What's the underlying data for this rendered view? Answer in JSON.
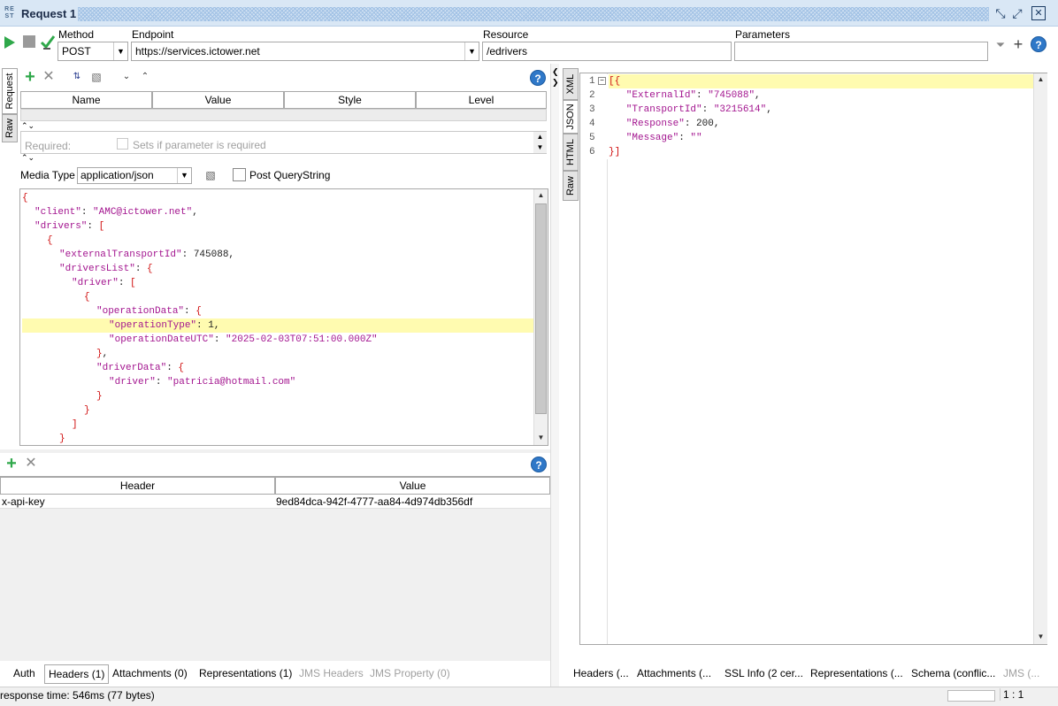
{
  "window": {
    "icon_text": "RE ST",
    "title": "Request 1"
  },
  "toolbar": {
    "method_label": "Method",
    "method_value": "POST",
    "endpoint_label": "Endpoint",
    "endpoint_value": "https://services.ictower.net",
    "resource_label": "Resource",
    "resource_value": "/edrivers",
    "parameters_label": "Parameters",
    "parameters_value": ""
  },
  "request_tabs": [
    "Request",
    "Raw"
  ],
  "response_tabs": [
    "XML",
    "JSON",
    "HTML",
    "Raw"
  ],
  "params_table": {
    "columns": [
      "Name",
      "Value",
      "Style",
      "Level"
    ],
    "required_label": "Required:",
    "required_hint": "Sets if parameter is required"
  },
  "media": {
    "label": "Media Type",
    "value": "application/json",
    "post_qs_label": "Post QueryString"
  },
  "request_body": [
    {
      "indent": 0,
      "tokens": [
        [
          "b",
          "{"
        ]
      ]
    },
    {
      "indent": 1,
      "tokens": [
        [
          "k",
          "\"client\""
        ],
        [
          "n",
          ": "
        ],
        [
          "s",
          "\"AMC@ictower.net\""
        ],
        [
          "n",
          ","
        ]
      ]
    },
    {
      "indent": 1,
      "tokens": [
        [
          "k",
          "\"drivers\""
        ],
        [
          "n",
          ": "
        ],
        [
          "b",
          "["
        ]
      ]
    },
    {
      "indent": 2,
      "tokens": [
        [
          "b",
          "{"
        ]
      ]
    },
    {
      "indent": 3,
      "tokens": [
        [
          "k",
          "\"externalTransportId\""
        ],
        [
          "n",
          ": "
        ],
        [
          "n",
          "745088,"
        ]
      ]
    },
    {
      "indent": 3,
      "tokens": [
        [
          "k",
          "\"driversList\""
        ],
        [
          "n",
          ": "
        ],
        [
          "b",
          "{"
        ]
      ]
    },
    {
      "indent": 4,
      "tokens": [
        [
          "k",
          "\"driver\""
        ],
        [
          "n",
          ": "
        ],
        [
          "b",
          "["
        ]
      ]
    },
    {
      "indent": 5,
      "tokens": [
        [
          "b",
          "{"
        ]
      ]
    },
    {
      "indent": 6,
      "tokens": [
        [
          "k",
          "\"operationData\""
        ],
        [
          "n",
          ": "
        ],
        [
          "b",
          "{"
        ]
      ]
    },
    {
      "indent": 7,
      "tokens": [
        [
          "k",
          "\"operationType\""
        ],
        [
          "n",
          ": 1,"
        ]
      ],
      "highlight": true
    },
    {
      "indent": 7,
      "tokens": [
        [
          "k",
          "\"operationDateUTC\""
        ],
        [
          "n",
          ": "
        ],
        [
          "s",
          "\"2025-02-03T07:51:00.000Z\""
        ]
      ]
    },
    {
      "indent": 6,
      "tokens": [
        [
          "b",
          "}"
        ],
        [
          "n",
          ","
        ]
      ]
    },
    {
      "indent": 6,
      "tokens": [
        [
          "k",
          "\"driverData\""
        ],
        [
          "n",
          ": "
        ],
        [
          "b",
          "{"
        ]
      ]
    },
    {
      "indent": 7,
      "tokens": [
        [
          "k",
          "\"driver\""
        ],
        [
          "n",
          ": "
        ],
        [
          "s",
          "\"patricia@hotmail.com\""
        ]
      ]
    },
    {
      "indent": 6,
      "tokens": [
        [
          "b",
          "}"
        ]
      ]
    },
    {
      "indent": 5,
      "tokens": [
        [
          "b",
          "}"
        ]
      ]
    },
    {
      "indent": 4,
      "tokens": [
        [
          "b",
          "]"
        ]
      ]
    },
    {
      "indent": 3,
      "tokens": [
        [
          "b",
          "}"
        ]
      ]
    }
  ],
  "headers_table": {
    "columns": [
      "Header",
      "Value"
    ],
    "rows": [
      {
        "header": "x-api-key",
        "value": "9ed84dca-942f-4777-aa84-4d974db356df"
      }
    ]
  },
  "request_bottom_tabs": [
    {
      "label": "Auth",
      "state": "normal"
    },
    {
      "label": "Headers (1)",
      "state": "active"
    },
    {
      "label": "Attachments (0)",
      "state": "normal"
    },
    {
      "label": "Representations (1)",
      "state": "normal"
    },
    {
      "label": "JMS Headers",
      "state": "disabled"
    },
    {
      "label": "JMS Property (0)",
      "state": "disabled"
    }
  ],
  "response_body": [
    {
      "num": "1",
      "tokens": [
        [
          "b",
          "[{"
        ]
      ],
      "highlight": true
    },
    {
      "num": "2",
      "tokens": [
        [
          "k",
          "   \"ExternalId\""
        ],
        [
          "n",
          ": "
        ],
        [
          "s",
          "\"745088\""
        ],
        [
          "n",
          ","
        ]
      ]
    },
    {
      "num": "3",
      "tokens": [
        [
          "k",
          "   \"TransportId\""
        ],
        [
          "n",
          ": "
        ],
        [
          "s",
          "\"3215614\""
        ],
        [
          "n",
          ","
        ]
      ]
    },
    {
      "num": "4",
      "tokens": [
        [
          "k",
          "   \"Response\""
        ],
        [
          "n",
          ": 200,"
        ]
      ]
    },
    {
      "num": "5",
      "tokens": [
        [
          "k",
          "   \"Message\""
        ],
        [
          "n",
          ": "
        ],
        [
          "s",
          "\"\""
        ]
      ]
    },
    {
      "num": "6",
      "tokens": [
        [
          "b",
          "}]"
        ]
      ]
    }
  ],
  "response_bottom_tabs": [
    {
      "label": "Headers (...",
      "state": "normal"
    },
    {
      "label": "Attachments (...",
      "state": "normal"
    },
    {
      "label": "SSL Info (2 cer...",
      "state": "normal"
    },
    {
      "label": "Representations (...",
      "state": "normal"
    },
    {
      "label": "Schema (conflic...",
      "state": "normal"
    },
    {
      "label": "JMS (...",
      "state": "disabled"
    }
  ],
  "status": {
    "response_time": "response time: 546ms (77 bytes)",
    "position": "1 : 1"
  }
}
